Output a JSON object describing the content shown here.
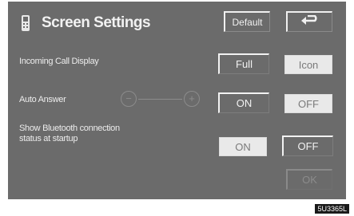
{
  "header": {
    "title": "Screen Settings",
    "default_label": "Default",
    "back_icon": "back-arrow-icon",
    "phone_icon": "phone-icon"
  },
  "settings": {
    "incoming_call": {
      "label": "Incoming Call Display",
      "options": [
        "Full",
        "Icon"
      ],
      "selected": "Icon"
    },
    "auto_answer": {
      "label": "Auto Answer",
      "minus": "−",
      "plus": "+",
      "options": [
        "ON",
        "OFF"
      ],
      "selected": "OFF"
    },
    "bluetooth_status": {
      "label_line1": "Show Bluetooth connection",
      "label_line2": "status at startup",
      "options": [
        "ON",
        "OFF"
      ],
      "selected": "ON"
    }
  },
  "footer": {
    "ok_label": "OK",
    "image_code": "5U3365L"
  }
}
